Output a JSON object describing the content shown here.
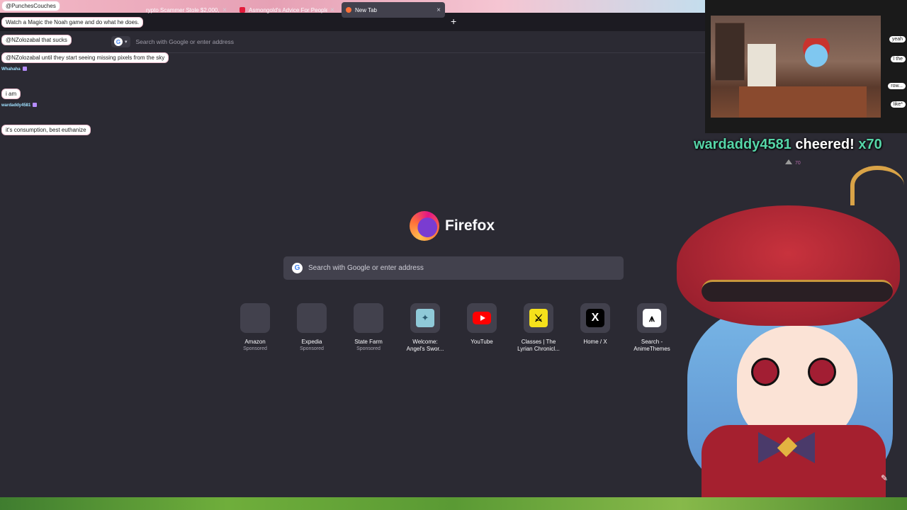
{
  "tabs": [
    {
      "label": "rypto Scammer Stole $2,000,0",
      "favicon_color": "#ffffff",
      "active": false
    },
    {
      "label": "Asmongold's Advice For People",
      "favicon_color": "#e31b3b",
      "active": false
    },
    {
      "label": "New Tab",
      "favicon_color": "#ff7139",
      "active": true
    }
  ],
  "new_tab_symbol": "+",
  "tab_close_symbol": "×",
  "url_bar": {
    "placeholder": "Search with Google or enter address",
    "engine_icon": "google-icon"
  },
  "chat": {
    "top_user": "@PunchesCouches",
    "lines": [
      {
        "text": "Watch a Magic the Noah game and do what he does."
      },
      {
        "text": "@NZolozabal that sucks"
      },
      {
        "text": "@NZolozabal until they start seeing missing pixels from the sky"
      },
      {
        "user": "Whahaha"
      },
      {
        "text": "i am"
      },
      {
        "user": "wardaddy4581"
      },
      {
        "text": "it's consumption, best euthanize"
      }
    ]
  },
  "brand": {
    "name": "Firefox"
  },
  "search": {
    "placeholder": "Search with Google or enter address"
  },
  "tiles": [
    {
      "title": "Amazon",
      "sub": "Sponsored",
      "icon": "blank"
    },
    {
      "title": "Expedia",
      "sub": "Sponsored",
      "icon": "blank"
    },
    {
      "title": "State Farm",
      "sub": "Sponsored",
      "icon": "blank"
    },
    {
      "title": "Welcome:",
      "sub": "Angel's Swor...",
      "icon": "angel-icon"
    },
    {
      "title": "YouTube",
      "sub": "",
      "icon": "youtube-icon"
    },
    {
      "title": "Classes | The",
      "sub": "Lyrian Chronicl...",
      "icon": "lyrian-icon"
    },
    {
      "title": "Home / X",
      "sub": "",
      "icon": "x-icon"
    },
    {
      "title": "Search -",
      "sub": "AnimeThemes",
      "icon": "animethemes-icon"
    }
  ],
  "side_chat": [
    "yeah",
    "l the",
    "row...",
    "like*"
  ],
  "cheer": {
    "name": "wardaddy4581",
    "text": " cheered! ",
    "amount": "x70",
    "bits": "70"
  },
  "colors": {
    "background": "#2b2a33",
    "tab_bar": "#1c1b22",
    "accent": "#56d6a8"
  }
}
